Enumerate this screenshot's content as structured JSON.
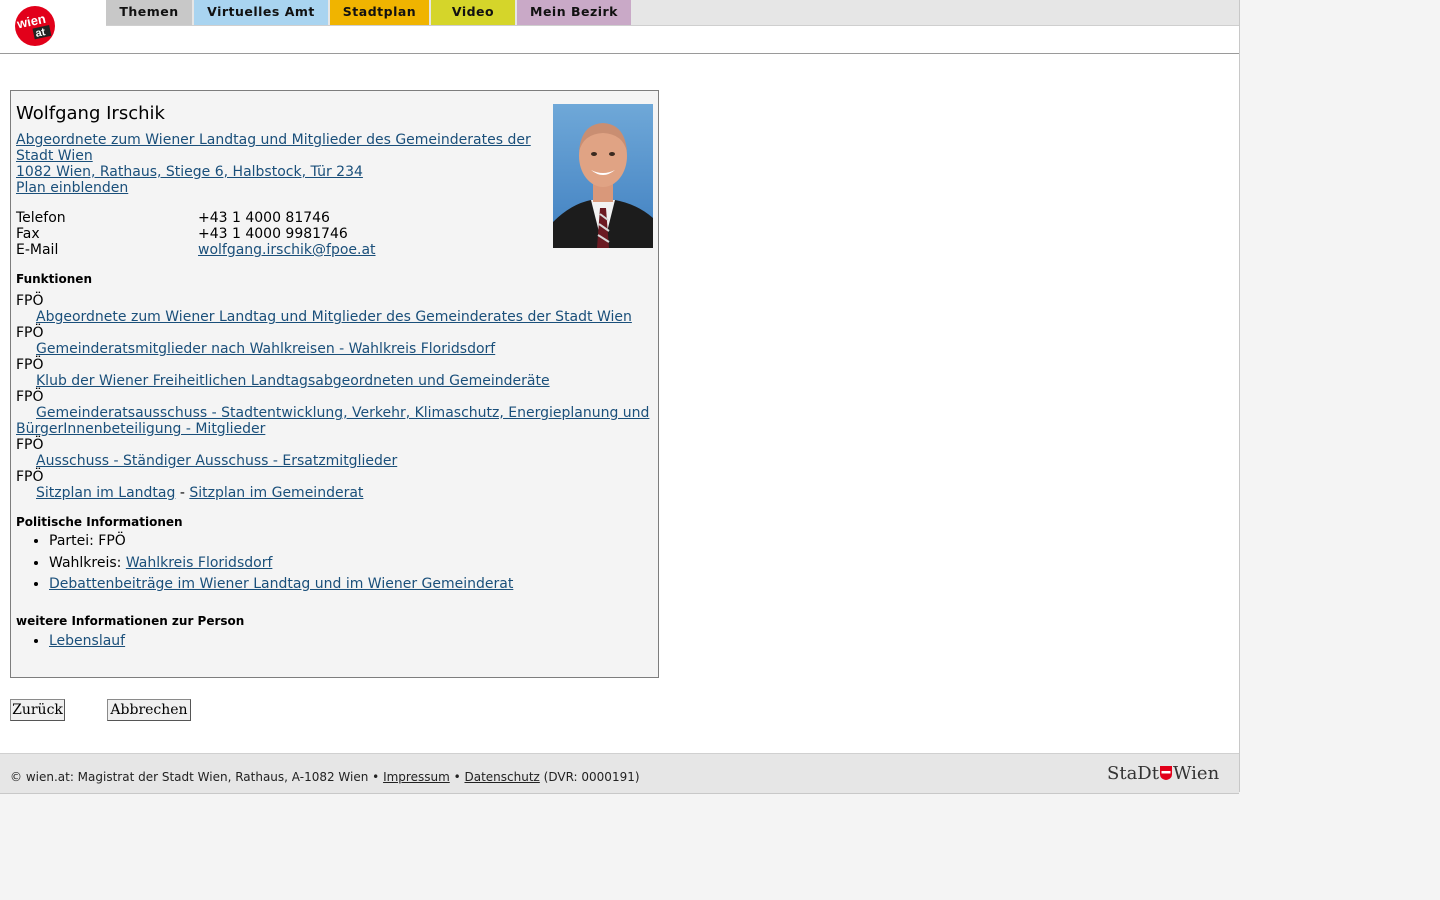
{
  "nav": {
    "tabs": [
      {
        "label": "Themen",
        "color": "#c8c8c8"
      },
      {
        "label": "Virtuelles Amt",
        "color": "#a9d4f0"
      },
      {
        "label": "Stadtplan",
        "color": "#f0b400"
      },
      {
        "label": "Video",
        "color": "#d5d52a"
      },
      {
        "label": "Mein Bezirk",
        "color": "#c9a9c7"
      }
    ]
  },
  "logo": {
    "line1": "wien",
    "line2": "at"
  },
  "person": {
    "name": "Wolfgang Irschik",
    "org_line1": "Abgeordnete zum Wiener Landtag und Mitglieder des Gemeinderates der",
    "org_line2": "Stadt Wien ",
    "address": "1082 Wien, Rathaus, Stiege 6, Halbstock, Tür 234",
    "plan_link": "Plan einblenden",
    "contacts": [
      {
        "label": "Telefon",
        "value": "+43 1 4000 81746"
      },
      {
        "label": "Fax",
        "value": "+43 1 4000 9981746"
      },
      {
        "label": "E-Mail",
        "value": "wolfgang.irschik@fpoe.at"
      }
    ]
  },
  "functions": {
    "heading": "Funktionen",
    "party": "FPÖ",
    "items": [
      "Abgeordnete zum Wiener Landtag und Mitglieder des Gemeinderates der Stadt Wien",
      "Gemeinderatsmitglieder nach Wahlkreisen - Wahlkreis Floridsdorf",
      "Klub der Wiener Freiheitlichen Landtagsabgeordneten und Gemeinderäte",
      "Gemeinderatsausschuss - Stadtentwicklung, Verkehr, Klimaschutz, Energieplanung und",
      "BürgerInnenbeteiligung - Mitglieder",
      "Ausschuss - Ständiger Ausschuss - Ersatzmitglieder",
      "Sitzplan im Landtag",
      " - ",
      "Sitzplan im Gemeinderat"
    ]
  },
  "political": {
    "heading": "Politische Informationen",
    "party_label": "Partei: FPÖ",
    "district_label": "Wahlkreis: ",
    "district_link": "Wahlkreis Floridsdorf",
    "debates_link": "Debattenbeiträge im Wiener Landtag und im Wiener Gemeinderat"
  },
  "more": {
    "heading": "weitere Informationen zur Person",
    "cv_link": "Lebenslauf"
  },
  "buttons": {
    "back": "Zurück",
    "cancel": "Abbrechen"
  },
  "footer": {
    "copyright": "© wien.at: Magistrat der Stadt Wien, Rathaus, A-1082 Wien • ",
    "impressum": "Impressum",
    "sep": " • ",
    "datenschutz": "Datenschutz",
    "dvr": " (DVR: 0000191)",
    "brand_a": "StaDt",
    "brand_b": "Wien"
  },
  "colors": {
    "link": "#1a4f7a",
    "logo_red": "#e2001a"
  }
}
